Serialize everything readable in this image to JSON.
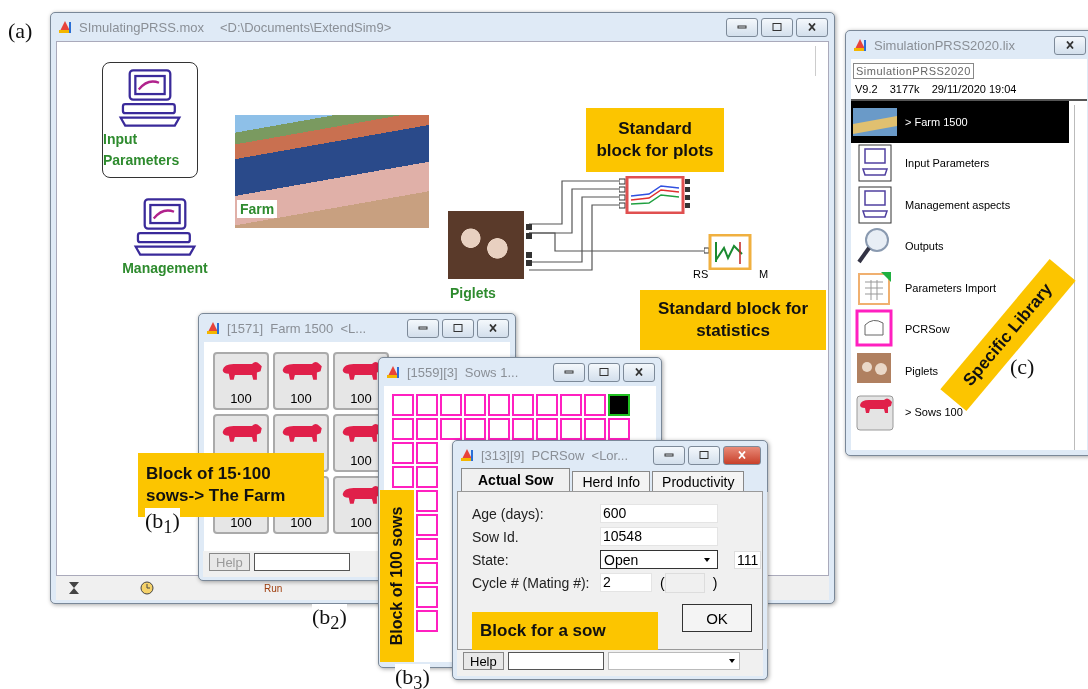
{
  "figure_labels": [
    {
      "kind": "a",
      "text": "(a)"
    },
    {
      "kind": "b1",
      "text": "(b$_{1}$)"
    },
    {
      "kind": "b2",
      "text": "(b$_{2}$)"
    },
    {
      "kind": "b3",
      "text": "(b$_{3}$)"
    },
    {
      "kind": "c",
      "text": "(c)"
    }
  ],
  "model_window": {
    "title": "SImulatingPRSS.mox",
    "path": "<D:\\Documents\\ExtendSim9>",
    "blocks": [
      {
        "kind": "computer",
        "label": "Input Parameters",
        "framed": true
      },
      {
        "kind": "computer",
        "label": "Management",
        "framed": false
      },
      {
        "kind": "farm_photo",
        "label": "Farm"
      },
      {
        "kind": "piglets_photo",
        "label": "Piglets"
      }
    ],
    "stat_ports": {
      "left": "RS",
      "right": "M"
    },
    "status_bar": {
      "run": "Run"
    }
  },
  "farm_window": {
    "title": "[1571]  Farm 1500  <L...",
    "tiles": [
      {
        "kind": "labeled",
        "count": "100"
      },
      {
        "kind": "labeled",
        "count": "100"
      },
      {
        "kind": "labeled",
        "count": "100"
      },
      {
        "kind": "unlabeled"
      },
      {
        "kind": "unlabeled"
      },
      {
        "kind": "labeled",
        "count": "100"
      },
      {
        "kind": "labeled",
        "count": "100"
      },
      {
        "kind": "labeled",
        "count": "100"
      },
      {
        "kind": "labeled",
        "count": "100"
      }
    ],
    "help": "Help"
  },
  "sows_window": {
    "title": "[1559][3]  Sows 1...",
    "rows": [
      {
        "cells": [
          {
            "selected": false
          },
          {
            "selected": false
          },
          {
            "selected": false
          },
          {
            "selected": false
          },
          {
            "selected": false
          },
          {
            "selected": false
          },
          {
            "selected": false
          },
          {
            "selected": false
          },
          {
            "selected": false
          },
          {
            "selected": true
          }
        ]
      },
      {
        "cells": [
          {
            "selected": false
          },
          {
            "selected": false
          },
          {
            "selected": false
          },
          {
            "selected": false
          },
          {
            "selected": false
          },
          {
            "selected": false
          },
          {
            "selected": false
          },
          {
            "selected": false
          },
          {
            "selected": false
          },
          {
            "selected": false
          }
        ]
      },
      {
        "cells": [
          {
            "selected": false
          },
          {
            "selected": false
          }
        ]
      },
      {
        "cells": [
          {
            "selected": false
          },
          {
            "selected": false
          }
        ]
      },
      {
        "cells": [
          {
            "selected": false
          }
        ]
      },
      {
        "cells": [
          {
            "selected": false
          }
        ]
      },
      {
        "cells": [
          {
            "selected": false
          }
        ]
      },
      {
        "cells": [
          {
            "selected": false
          }
        ]
      },
      {
        "cells": [
          {
            "selected": false
          }
        ]
      },
      {
        "cells": [
          {
            "selected": false
          }
        ]
      }
    ]
  },
  "sow_dialog": {
    "title": "[313][9]  PCRSow  <Lor...",
    "tabs": [
      {
        "label": "Actual Sow",
        "selected": true
      },
      {
        "label": "Herd Info",
        "selected": false
      },
      {
        "label": "Productivity",
        "selected": false
      }
    ],
    "fields": [
      {
        "kind": "text",
        "label": "Age (days):",
        "value": "600"
      },
      {
        "kind": "text",
        "label": "Sow Id.",
        "value": "10548"
      },
      {
        "kind": "dropdown",
        "label": "State:",
        "value": "Open",
        "side": "111"
      },
      {
        "kind": "paren",
        "label": "Cycle # (Mating #):",
        "value": "2",
        "open": "(",
        "close": ")"
      }
    ],
    "ok": "OK",
    "help": "Help"
  },
  "library_window": {
    "title": "SimulationPRSS2020.lix",
    "name_field": "SimulationPRSS2020",
    "version": "V9.2",
    "size": "3177k",
    "date": "29/11/2020 19:04",
    "items": [
      {
        "kind": "farm",
        "label": "> Farm 1500",
        "selected": true
      },
      {
        "kind": "computer",
        "label": "Input Parameters",
        "selected": false
      },
      {
        "kind": "computer",
        "label": "Management aspects",
        "selected": false
      },
      {
        "kind": "magnifier",
        "label": "Outputs",
        "selected": false
      },
      {
        "kind": "table",
        "label": "Parameters Import",
        "selected": false
      },
      {
        "kind": "sow",
        "label": "PCRSow",
        "selected": false
      },
      {
        "kind": "photo",
        "label": "Piglets",
        "selected": false
      },
      {
        "kind": "pig",
        "label": "> Sows 100",
        "selected": false
      }
    ]
  },
  "callouts": [
    {
      "kind": "plots",
      "text": "Standard block for plots"
    },
    {
      "kind": "statistics",
      "text": "Standard block for statistics"
    },
    {
      "kind": "farm",
      "text": "Block of 15·100 sows-> The Farm"
    },
    {
      "kind": "sows",
      "text": "Block of 100 sows"
    },
    {
      "kind": "library",
      "text": "Specific Library"
    },
    {
      "kind": "sow",
      "text": "Block for a sow"
    }
  ]
}
